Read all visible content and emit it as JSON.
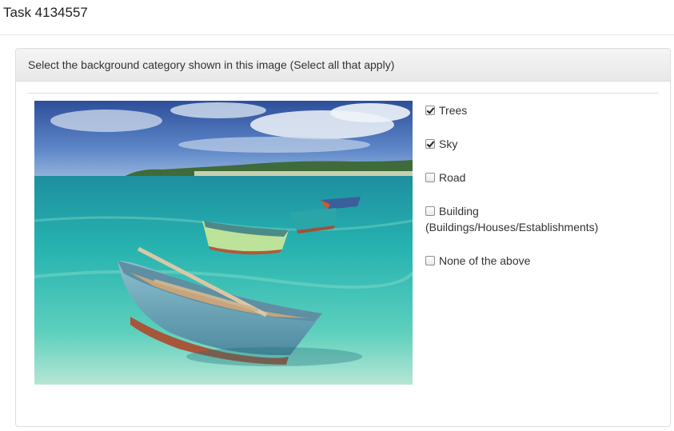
{
  "page": {
    "title": "Task 4134557"
  },
  "panel": {
    "heading": "Select the background category shown in this image (Select all that apply)"
  },
  "options": [
    {
      "label": "Trees",
      "checked": true
    },
    {
      "label": "Sky",
      "checked": true
    },
    {
      "label": "Road",
      "checked": false
    },
    {
      "label": "Building",
      "sub": "(Buildings/Houses/Establishments)",
      "checked": false
    },
    {
      "label": "None of the above",
      "checked": false
    }
  ],
  "colors": {
    "sky": "#4a78c2",
    "sea": "#2fb3b0",
    "boat": "#6aa5b8"
  }
}
